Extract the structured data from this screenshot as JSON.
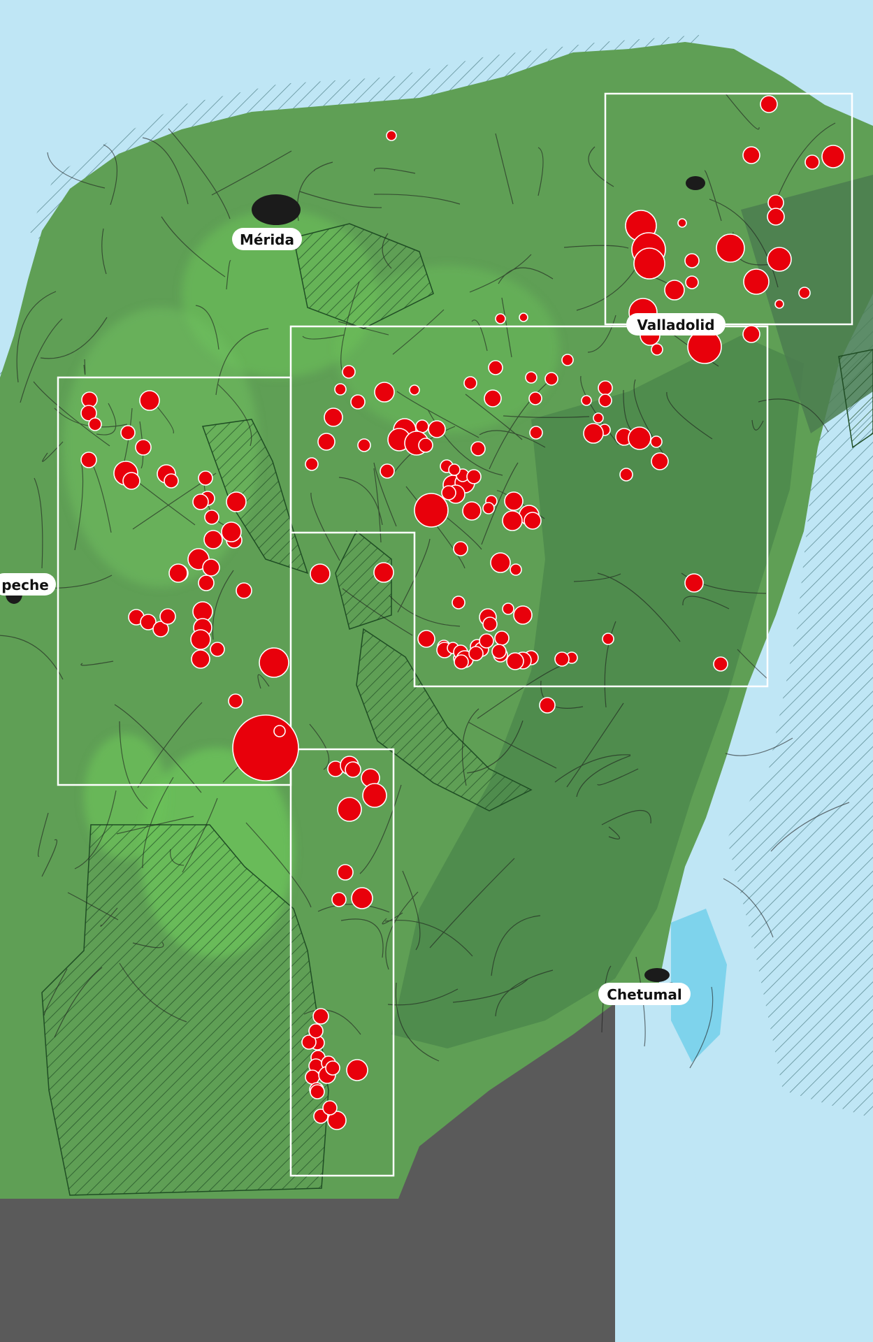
{
  "map": {
    "cities": [
      {
        "id": "merida",
        "label": "Mérida"
      },
      {
        "id": "valladolid",
        "label": "Valladolid"
      },
      {
        "id": "campeche",
        "label": "peche"
      },
      {
        "id": "chetumal",
        "label": "Chetumal"
      }
    ],
    "colors": {
      "ocean": "#bfe6f5",
      "land_low": "#5f9f55",
      "land_forest": "#4e8a4d",
      "land_bright": "#6cc25a",
      "land_dark": "#3f6f45",
      "belize": "#5a5a5a",
      "point": "#e8000b",
      "point_outline": "#ffffff",
      "study_box": "#ffffff",
      "protected_hatch": "#2a5a2a"
    },
    "legend": "none"
  }
}
